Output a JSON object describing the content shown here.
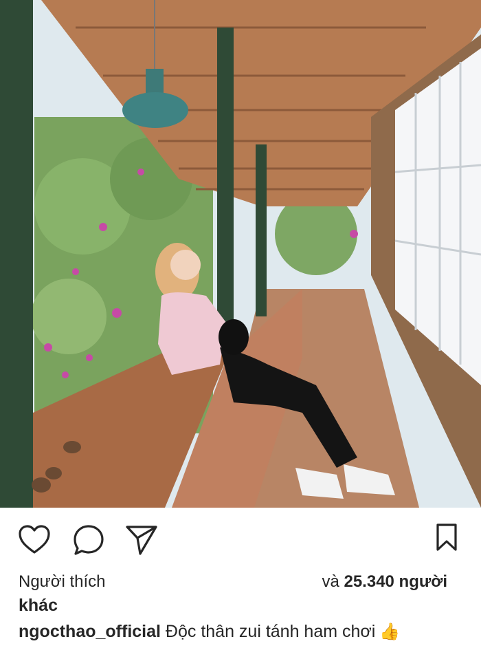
{
  "post": {
    "photo_alt": "photo",
    "actions": {
      "like_icon": "heart-icon",
      "comment_icon": "comment-icon",
      "share_icon": "send-icon",
      "save_icon": "bookmark-icon"
    },
    "likes": {
      "prefix": "Người thích",
      "and": "và",
      "count": "25.340 người",
      "suffix": "khác"
    },
    "caption": {
      "username": "ngocthao_official",
      "text": "Độc thân zui tánh ham chơi",
      "emoji": "👍"
    }
  },
  "colors": {
    "text": "#262626",
    "wood": "#a86a45",
    "pillar": "#2f4a36"
  }
}
